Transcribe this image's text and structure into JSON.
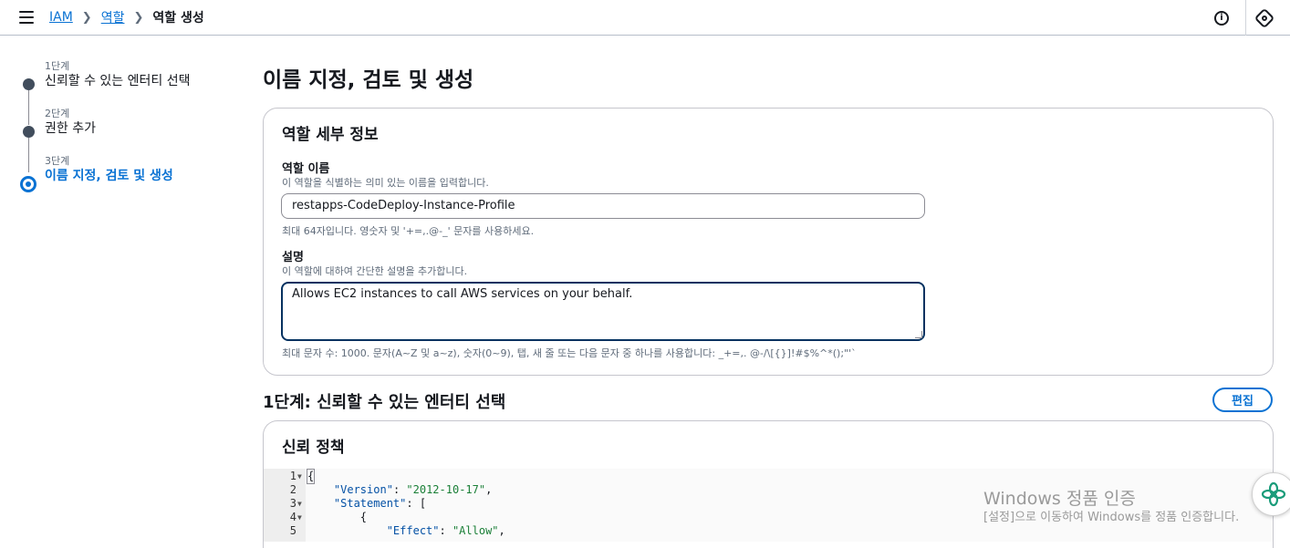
{
  "header": {
    "breadcrumb": [
      {
        "label": "IAM",
        "link": true
      },
      {
        "label": "역할",
        "link": true
      },
      {
        "label": "역할 생성",
        "link": false
      }
    ]
  },
  "steps": [
    {
      "number": "1단계",
      "title": "신뢰할 수 있는 엔터티 선택",
      "active": false
    },
    {
      "number": "2단계",
      "title": "권한 추가",
      "active": false
    },
    {
      "number": "3단계",
      "title": "이름 지정, 검토 및 생성",
      "active": true
    }
  ],
  "main": {
    "title": "이름 지정, 검토 및 생성",
    "role_details": {
      "title": "역할 세부 정보",
      "name_label": "역할 이름",
      "name_desc": "이 역할을 식별하는 의미 있는 이름을 입력합니다.",
      "name_value": "restapps-CodeDeploy-Instance-Profile",
      "name_hint": "최대 64자입니다. 영숫자 및 '+=,.@-_' 문자를 사용하세요.",
      "desc_label": "설명",
      "desc_desc": "이 역할에 대하여 간단한 설명을 추가합니다.",
      "desc_value": "Allows EC2 instances to call AWS services on your behalf.",
      "desc_hint": "최대 문자 수: 1000. 문자(A~Z 및 a~z), 숫자(0~9), 탭, 새 줄 또는 다음 문자 중 하나를 사용합니다: _+=,. @-/\\[{}]!#$%^*();\"'`"
    },
    "step1": {
      "title": "1단계: 신뢰할 수 있는 엔터티 선택",
      "edit_label": "편집",
      "policy_title": "신뢰 정책",
      "code": [
        {
          "ln": "1",
          "fold": true,
          "text": "{"
        },
        {
          "ln": "2",
          "fold": false,
          "key": "\"Version\"",
          "value": "\"2012-10-17\"",
          "tail": ","
        },
        {
          "ln": "3",
          "fold": true,
          "key": "\"Statement\"",
          "tail": ": ["
        },
        {
          "ln": "4",
          "fold": true,
          "text": "        {"
        },
        {
          "ln": "5",
          "fold": false,
          "key": "\"Effect\"",
          "value": "\"Allow\"",
          "tail": ","
        }
      ]
    }
  },
  "watermark": {
    "line1": "Windows 정품 인증",
    "line2": "[설정]으로 이동하여 Windows를 정품 인증합니다."
  }
}
